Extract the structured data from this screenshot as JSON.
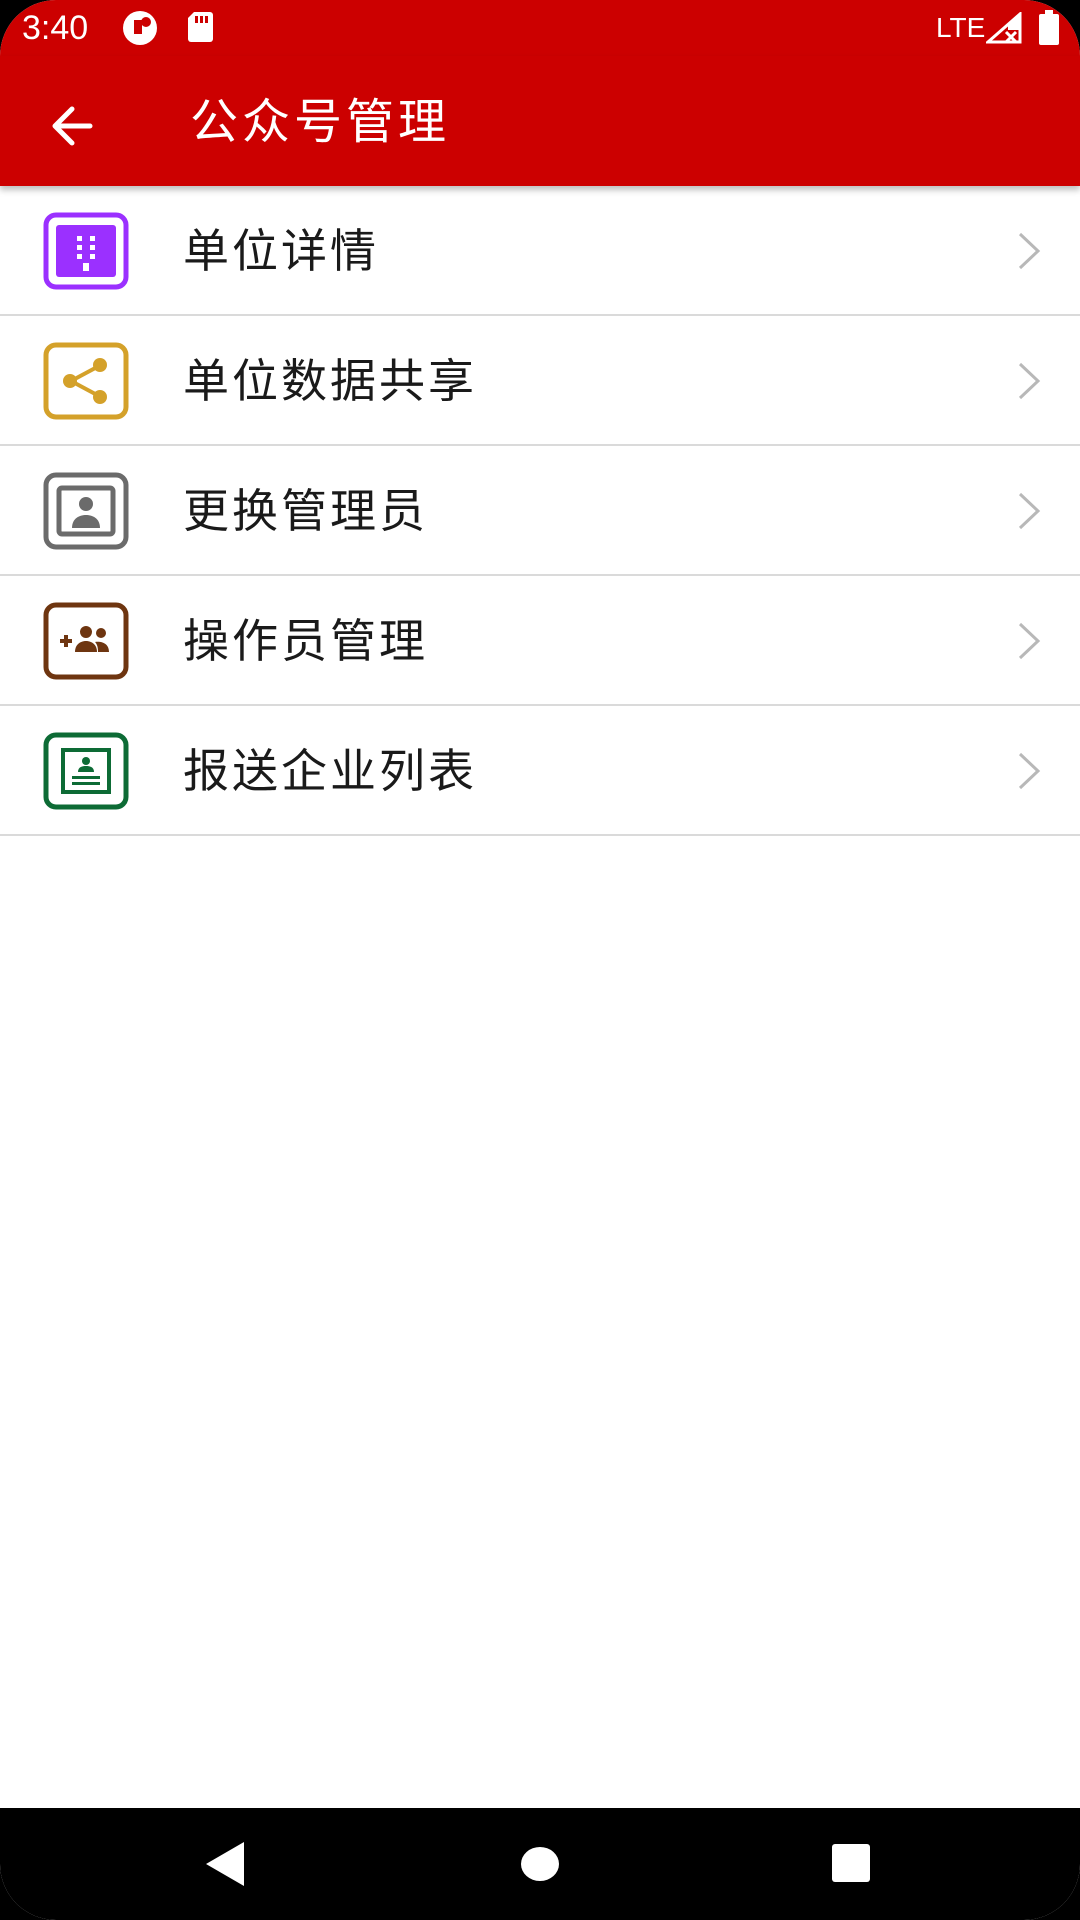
{
  "status_bar": {
    "time": "3:40",
    "network": "LTE",
    "icons": [
      "notification-icon",
      "sd-card-icon",
      "signal-icon",
      "battery-icon"
    ]
  },
  "app_bar": {
    "title": "公众号管理",
    "back_icon": "arrow-left-icon",
    "background_color": "#cc0000"
  },
  "menu": {
    "items": [
      {
        "label": "单位详情",
        "icon": "building-icon",
        "color": "#9b30ff"
      },
      {
        "label": "单位数据共享",
        "icon": "share-icon",
        "color": "#d4a12a"
      },
      {
        "label": "更换管理员",
        "icon": "contact-card-icon",
        "color": "#6b6b6b"
      },
      {
        "label": "操作员管理",
        "icon": "group-add-icon",
        "color": "#6e3510"
      },
      {
        "label": "报送企业列表",
        "icon": "document-list-icon",
        "color": "#0d6b35"
      }
    ],
    "chevron_icon": "chevron-right-icon"
  },
  "nav_bar": {
    "buttons": [
      "back-triangle-icon",
      "home-circle-icon",
      "recents-square-icon"
    ]
  }
}
